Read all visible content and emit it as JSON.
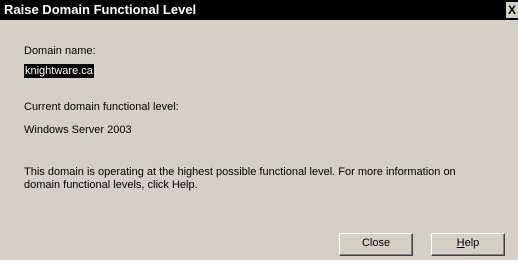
{
  "window": {
    "title": "Raise Domain Functional Level",
    "close_glyph": "X"
  },
  "domain": {
    "name_label": "Domain name:",
    "name_value": "knightware.ca",
    "level_label": "Current domain functional level:",
    "level_value": "Windows Server 2003"
  },
  "info": {
    "message": "This domain is operating at the highest possible functional level. For more information on domain functional levels, click Help."
  },
  "buttons": {
    "close_label": "Close",
    "help_mnemonic": "H",
    "help_rest": "elp"
  },
  "colors": {
    "titlebar": "#000000",
    "dialog_bg": "#d4d0c8",
    "selection_bg": "#000000"
  }
}
